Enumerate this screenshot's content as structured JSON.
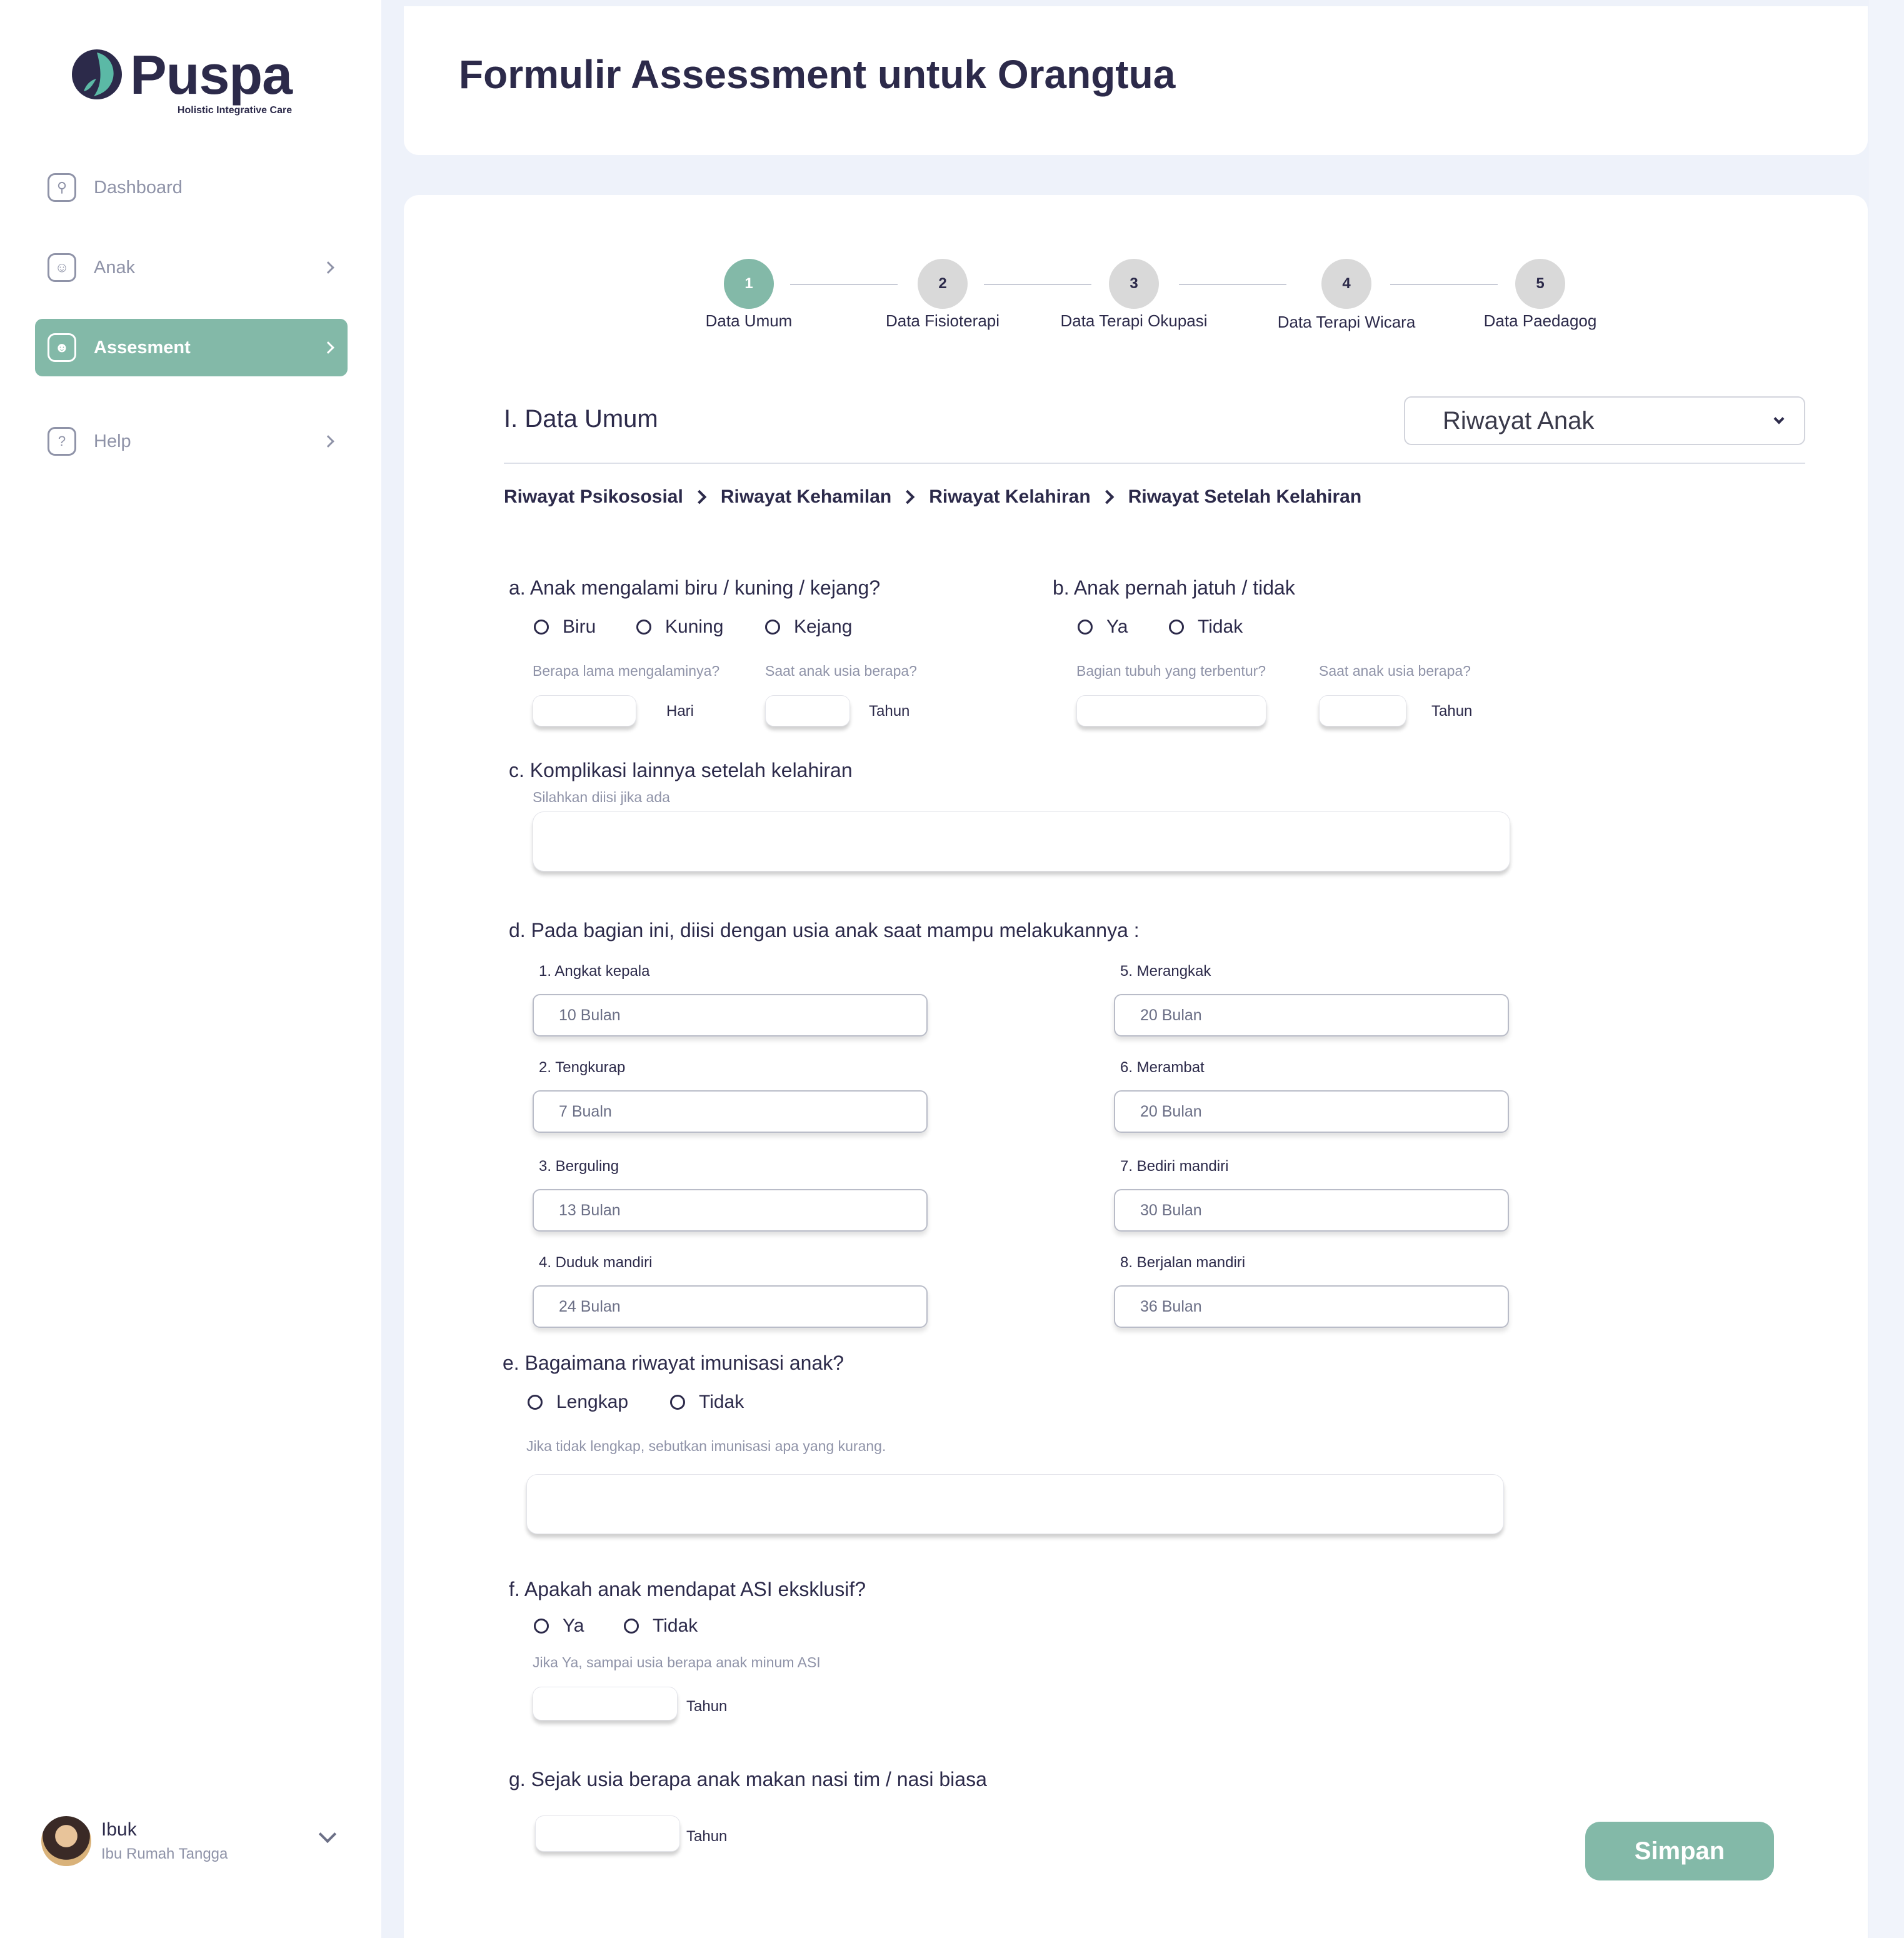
{
  "app": {
    "brand": "Puspa",
    "tagline": "Holistic Integrative Care"
  },
  "sidebar": {
    "items": [
      {
        "label": "Dashboard",
        "icon": "dashboard-icon"
      },
      {
        "label": "Anak",
        "icon": "child-face-icon"
      },
      {
        "label": "Assesment",
        "icon": "user-square-icon"
      },
      {
        "label": "Help",
        "icon": "help-bubble-icon"
      }
    ],
    "user": {
      "name": "Ibuk",
      "role": "Ibu Rumah Tangga"
    }
  },
  "header": {
    "title": "Formulir Assessment untuk Orangtua"
  },
  "stepper": [
    {
      "number": "1",
      "label": "Data Umum"
    },
    {
      "number": "2",
      "label": "Data Fisioterapi"
    },
    {
      "number": "3",
      "label": "Data Terapi Okupasi"
    },
    {
      "number": "4",
      "label": "Data Terapi Wicara"
    },
    {
      "number": "5",
      "label": "Data Paedagog"
    }
  ],
  "section": {
    "title": "I. Data Umum",
    "select_value": "Riwayat Anak"
  },
  "breadcrumb": [
    "Riwayat Psikososial",
    "Riwayat Kehamilan",
    "Riwayat Kelahiran",
    "Riwayat Setelah Kelahiran"
  ],
  "form": {
    "a": {
      "question": "a. Anak mengalami biru / kuning / kejang?",
      "options": [
        "Biru",
        "Kuning",
        "Kejang"
      ],
      "hint_duration": "Berapa lama mengalaminya?",
      "hint_age": "Saat anak usia berapa?",
      "unit_duration": "Hari",
      "unit_age": "Tahun"
    },
    "b": {
      "question": "b. Anak pernah jatuh / tidak",
      "options": [
        "Ya",
        "Tidak"
      ],
      "hint_part": "Bagian tubuh yang terbentur?",
      "hint_age": "Saat anak usia berapa?",
      "unit_age": "Tahun"
    },
    "c": {
      "question": "c. Komplikasi lainnya setelah kelahiran",
      "hint": "Silahkan diisi jika ada"
    },
    "d": {
      "question": "d. Pada bagian ini, diisi dengan usia anak saat mampu melakukannya :",
      "milestones": [
        {
          "label": "1. Angkat kepala",
          "value": "10 Bulan"
        },
        {
          "label": "2. Tengkurap",
          "value": "7 Bualn"
        },
        {
          "label": "3. Berguling",
          "value": "13 Bulan"
        },
        {
          "label": "4. Duduk mandiri",
          "value": "24 Bulan"
        },
        {
          "label": "5. Merangkak",
          "value": "20 Bulan"
        },
        {
          "label": "6. Merambat",
          "value": "20 Bulan"
        },
        {
          "label": "7. Bediri mandiri",
          "value": "30 Bulan"
        },
        {
          "label": "8. Berjalan mandiri",
          "value": "36 Bulan"
        }
      ]
    },
    "e": {
      "question": "e. Bagaimana riwayat imunisasi anak?",
      "options": [
        "Lengkap",
        "Tidak"
      ],
      "hint": "Jika tidak lengkap, sebutkan imunisasi apa yang kurang."
    },
    "f": {
      "question": "f. Apakah anak mendapat ASI eksklusif?",
      "options": [
        "Ya",
        "Tidak"
      ],
      "hint": "Jika Ya, sampai usia berapa anak minum ASI",
      "unit": "Tahun"
    },
    "g": {
      "question": "g. Sejak usia berapa anak makan nasi tim / nasi biasa",
      "unit": "Tahun"
    }
  },
  "actions": {
    "save_label": "Simpan"
  },
  "colors": {
    "accent": "#83b9a8",
    "text": "#2c2a4a",
    "muted": "#8f93a8",
    "background": "#eef2fa"
  }
}
